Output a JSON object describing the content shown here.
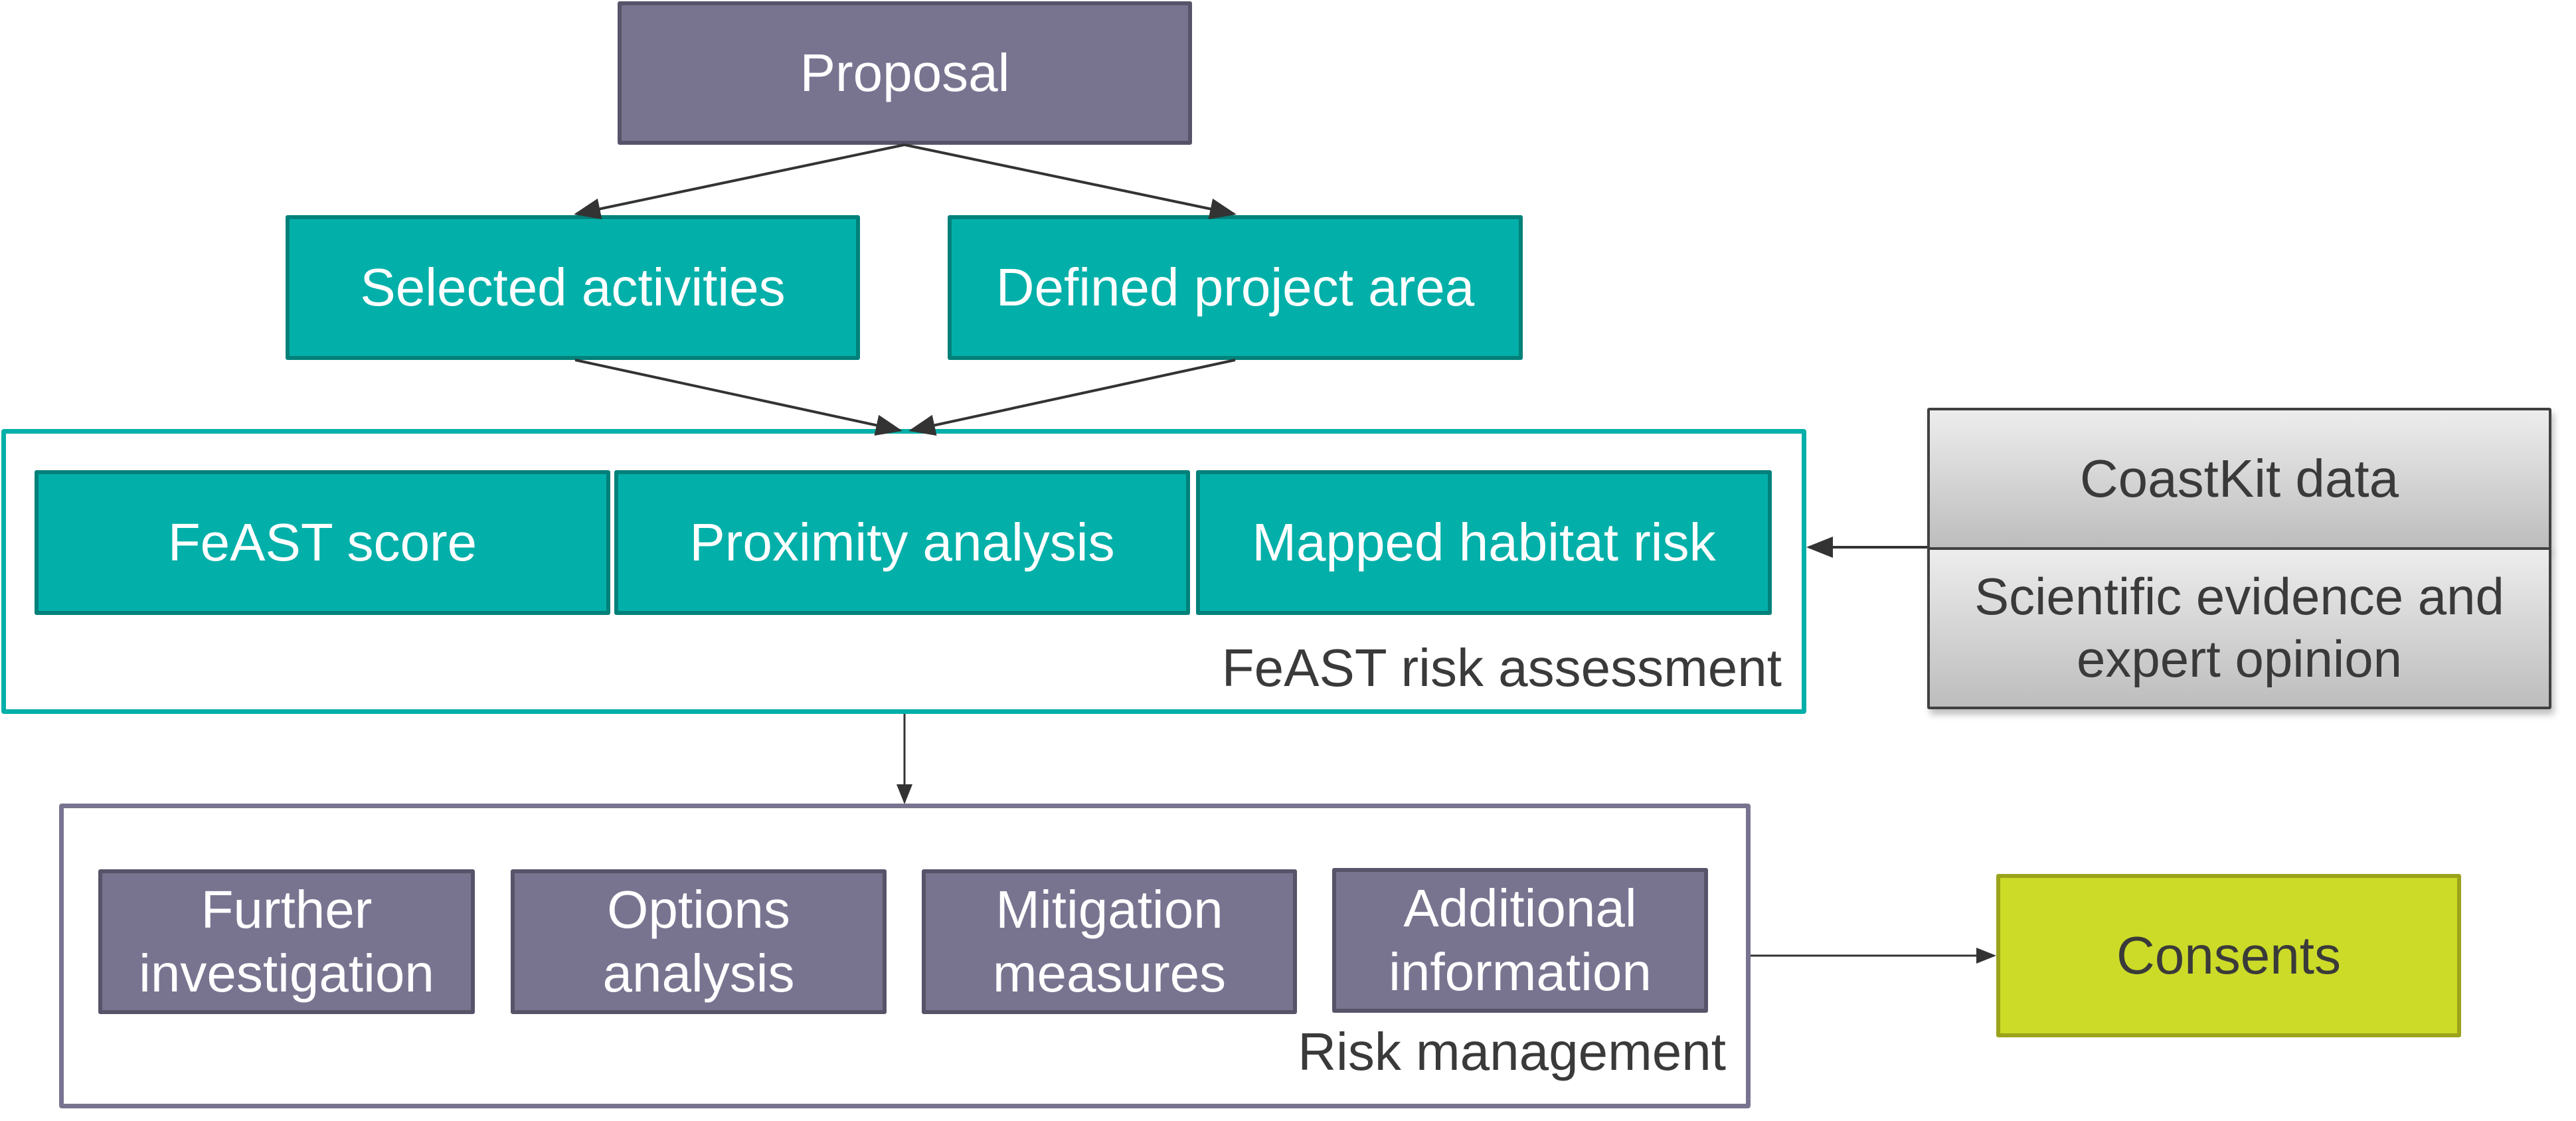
{
  "diagram": {
    "proposal": {
      "label": "Proposal"
    },
    "inputs": [
      {
        "label": "Selected activities"
      },
      {
        "label": "Defined project area"
      }
    ],
    "feast_group": {
      "caption": "FeAST risk assessment",
      "items": [
        {
          "label": "FeAST score"
        },
        {
          "label": "Proximity analysis"
        },
        {
          "label": "Mapped habitat risk"
        }
      ]
    },
    "evidence": {
      "top": "CoastKit data",
      "bottom": "Scientific evidence and expert opinion"
    },
    "risk_group": {
      "caption": "Risk management",
      "items": [
        {
          "line1": "Further",
          "line2": "investigation"
        },
        {
          "line1": "Options",
          "line2": "analysis"
        },
        {
          "line1": "Mitigation",
          "line2": "measures"
        },
        {
          "line1": "Additional",
          "line2": "information"
        }
      ]
    },
    "outcome": {
      "label": "Consents"
    },
    "colors": {
      "purple": "#787490",
      "teal": "#03B0A9",
      "lime": "#CCDB28",
      "gray": "#D6D6D6",
      "arrow": "#333333"
    }
  }
}
